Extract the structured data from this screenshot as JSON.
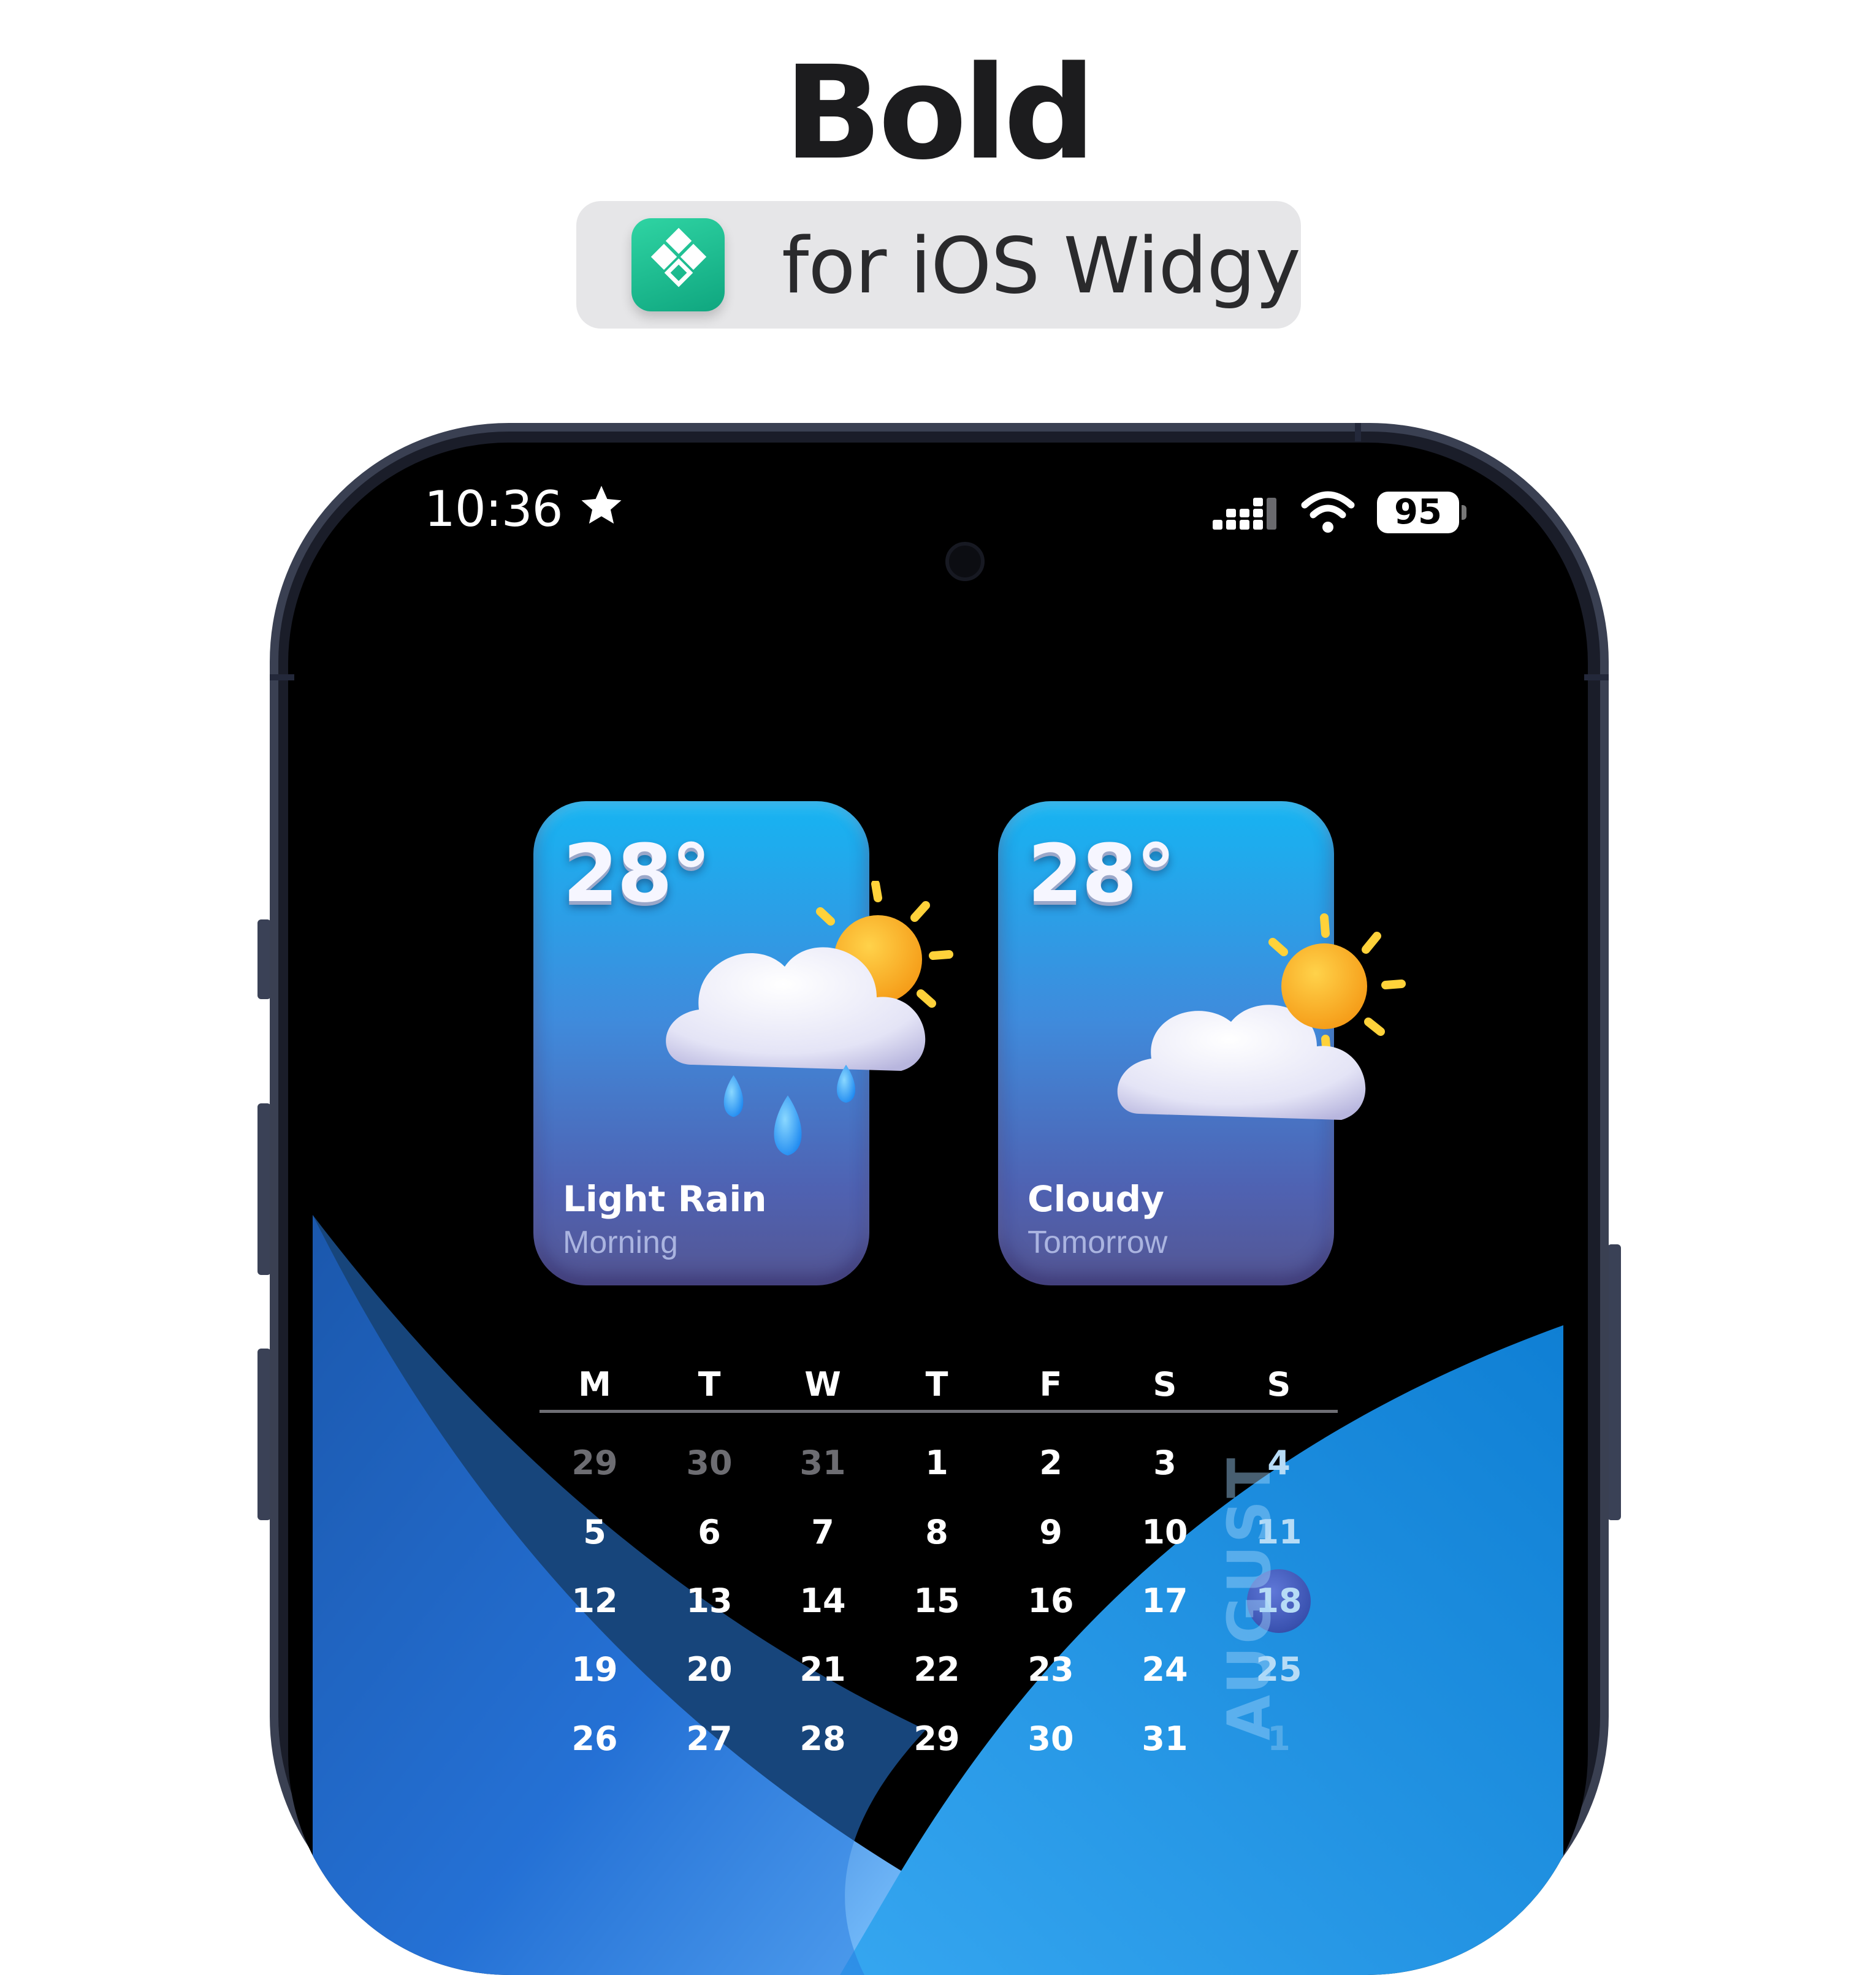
{
  "promo": {
    "title": "Bold",
    "subtitle": "for iOS Widgy",
    "app_icon": "widgy-app-icon"
  },
  "status_bar": {
    "time": "10:36",
    "location_icon": "star-icon",
    "signal_icon": "cellular-signal-icon",
    "wifi_icon": "wifi-icon",
    "battery_level": "95"
  },
  "widgets": [
    {
      "temperature": "28°",
      "condition": "Light Rain",
      "period": "Morning",
      "icon": "rain-cloud-sun-icon"
    },
    {
      "temperature": "28°",
      "condition": "Cloudy",
      "period": "Tomorrow",
      "icon": "cloud-sun-icon"
    }
  ],
  "calendar": {
    "month": "AUGUST",
    "weekdays": [
      "M",
      "T",
      "W",
      "T",
      "F",
      "S",
      "S"
    ],
    "weeks": [
      [
        "29",
        "30",
        "31",
        "1",
        "2",
        "3",
        "4"
      ],
      [
        "5",
        "6",
        "7",
        "8",
        "9",
        "10",
        "11"
      ],
      [
        "12",
        "13",
        "14",
        "15",
        "16",
        "17",
        "18"
      ],
      [
        "19",
        "20",
        "21",
        "22",
        "23",
        "24",
        "25"
      ],
      [
        "26",
        "27",
        "28",
        "29",
        "30",
        "31",
        "1"
      ]
    ],
    "today": "18",
    "colors": {
      "today": "#3a52b0",
      "weekend": "#b7dcf6",
      "outside_month": "#6d6d72"
    }
  }
}
